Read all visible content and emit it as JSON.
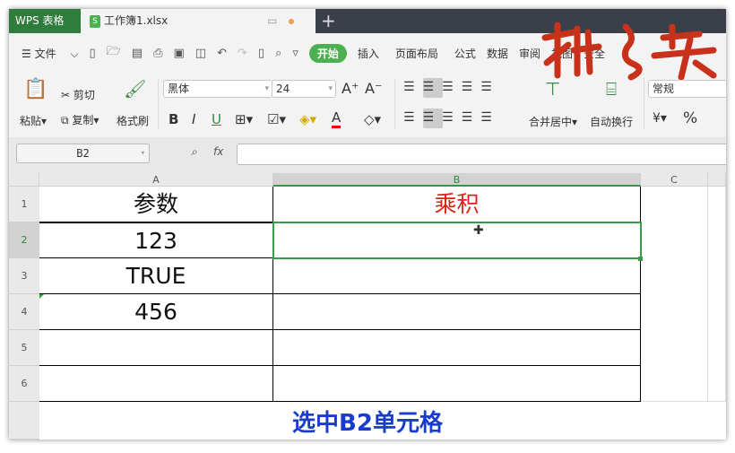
{
  "app": {
    "name": "WPS 表格",
    "doc_tab": "工作簿1.xlsx",
    "file_icon": "S"
  },
  "menu": {
    "file": "文件",
    "tabs": [
      "开始",
      "插入",
      "页面布局",
      "公式",
      "数据",
      "审阅",
      "视图",
      "安全"
    ]
  },
  "toolbar": {
    "paste": "粘贴",
    "cut": "剪切",
    "copy": "复制",
    "format_painter": "格式刷",
    "font": "黑体",
    "size": "24",
    "merge": "合并居中",
    "wrap": "自动换行",
    "number_format": "常规",
    "percent": "%"
  },
  "formula_bar": {
    "cell_ref": "B2",
    "fx": "fx",
    "value": ""
  },
  "sheet": {
    "columns": [
      "A",
      "B",
      "C"
    ],
    "rows": [
      "1",
      "2",
      "3",
      "4",
      "5",
      "6"
    ],
    "cells": {
      "A1": "参数",
      "B1": "乘积",
      "A2": "123",
      "A3": "TRUE",
      "A4": "456"
    },
    "selected": "B2"
  },
  "caption": "选中B2单元格",
  "colors": {
    "accent": "#4caf50",
    "header_red": "#e0201a",
    "caption": "#1a3ccc"
  }
}
